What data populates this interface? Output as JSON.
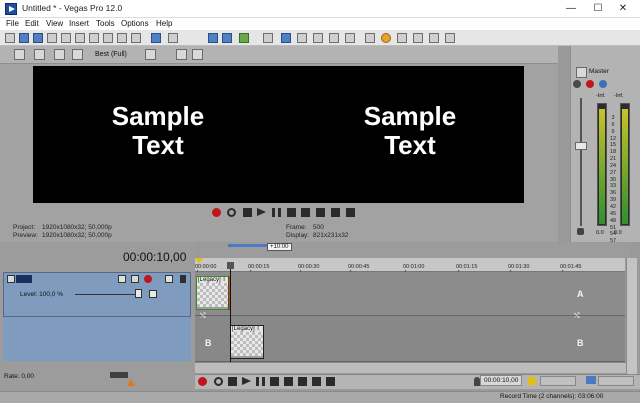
{
  "window": {
    "title": "Untitled * - Vegas Pro 12.0",
    "minimize": "—",
    "maximize": "☐",
    "close": "✕"
  },
  "menu": [
    "File",
    "Edit",
    "View",
    "Insert",
    "Tools",
    "Options",
    "Help"
  ],
  "preview": {
    "quality": "Best (Full)",
    "sample_left": "Sample\nText",
    "sample_right": "Sample\nText",
    "project_label": "Project:",
    "project_value": "1920x1080x32; 50,000p",
    "preview_label": "Preview:",
    "preview_value": "1920x1080x32; 50,000p",
    "frame_label": "Frame:",
    "frame_value": "500",
    "display_label": "Display:",
    "display_value": "821x231x32"
  },
  "master": {
    "label": "Master",
    "peak_left": "-Inf.",
    "peak_right": "-Inf.",
    "scale": [
      "3",
      "6",
      "9",
      "12",
      "15",
      "18",
      "21",
      "24",
      "27",
      "30",
      "33",
      "36",
      "39",
      "42",
      "45",
      "48",
      "51",
      "54",
      "57"
    ],
    "value_left": "0.0",
    "value_right": "0.0"
  },
  "timeline": {
    "current_time": "00:00:10,00",
    "edge_marker": "+10:00",
    "ruler_ticks": [
      "00:00:00",
      "00:00:15",
      "00:00:30",
      "00:00:45",
      "00:01:00",
      "00:01:15",
      "00:01:30",
      "00:01:45"
    ],
    "track_level": "Level: 100,0 %",
    "clip1_label": "[Legacy] T",
    "clip2_label": "[Legacy] T",
    "lane_letter_a": "A",
    "lane_letter_b": "B",
    "rate": "Rate: 0,00",
    "bottom_time": "00:00:10,00"
  },
  "status": {
    "record_time": "Record Time (2 channels): 03:06:00"
  },
  "colors": {
    "track_header": "#7f9bbd",
    "record": "#c0151b"
  }
}
